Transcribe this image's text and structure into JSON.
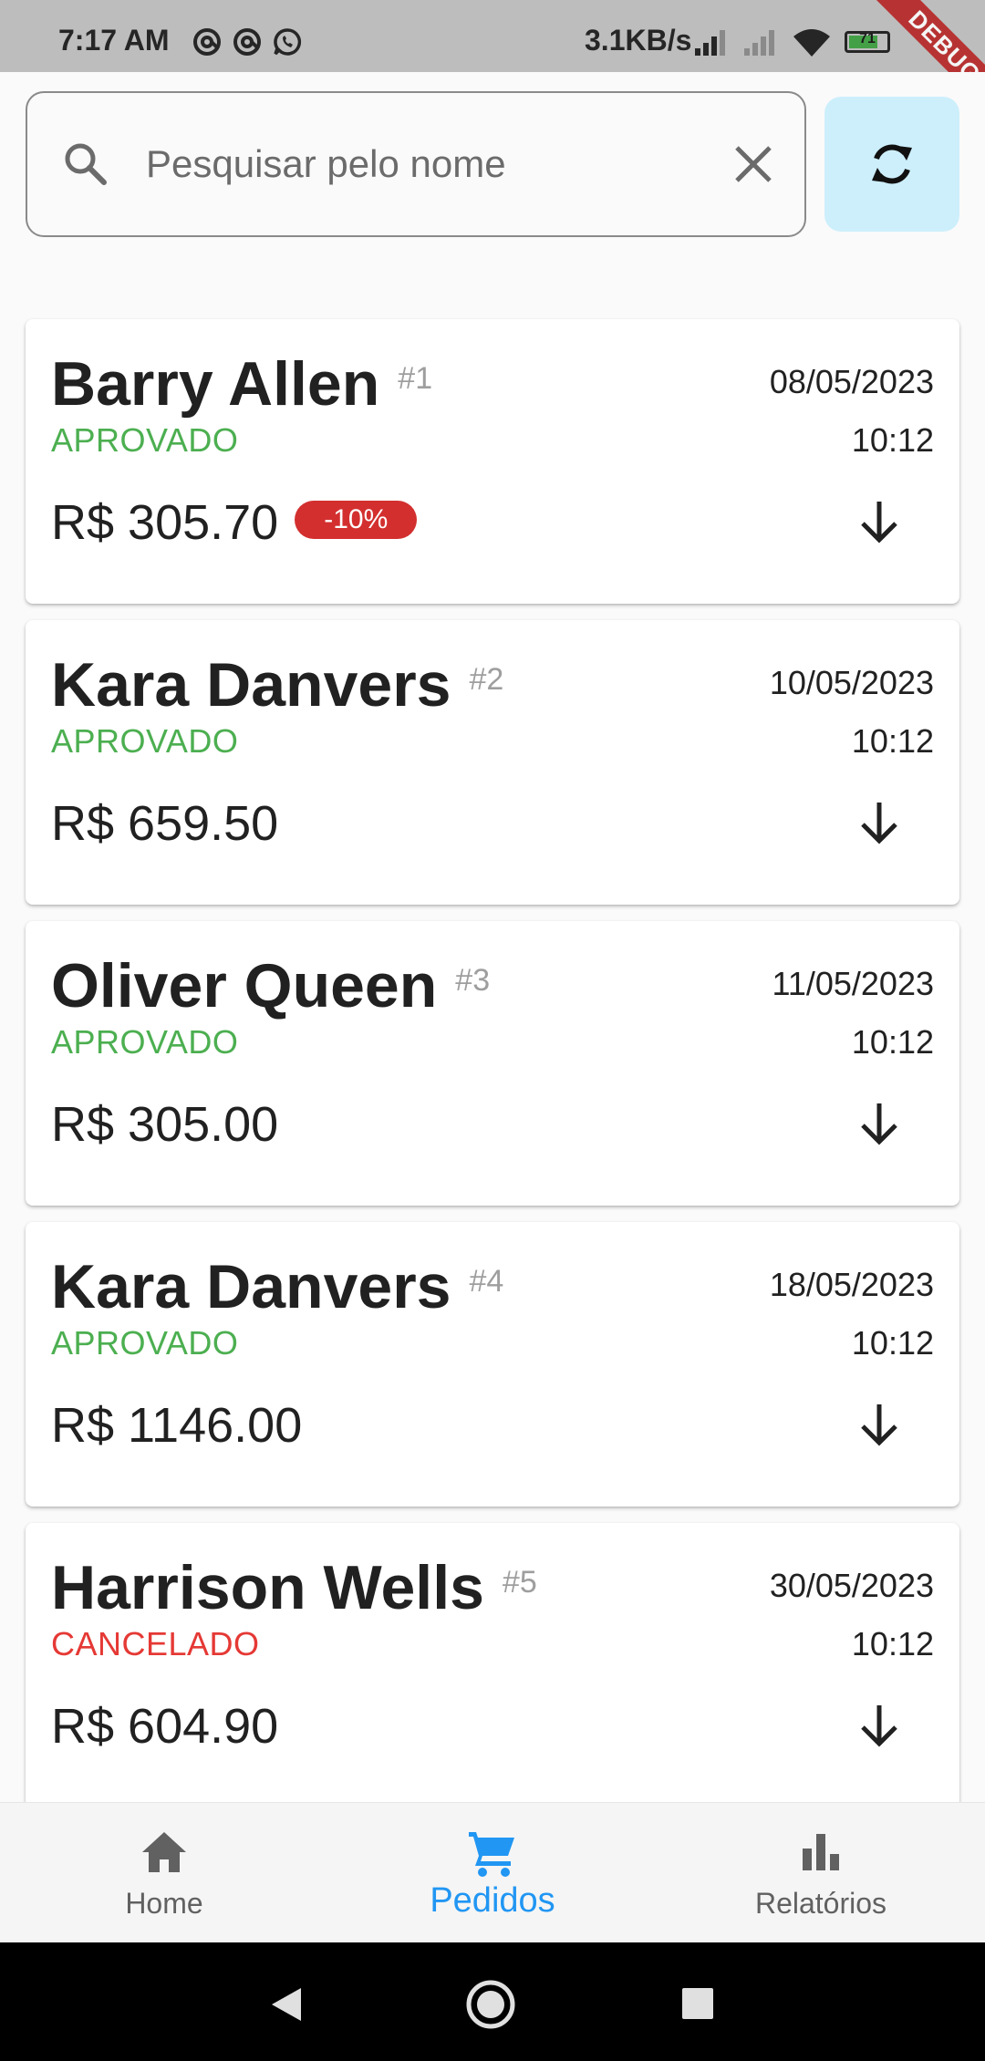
{
  "status_bar": {
    "time": "7:17 AM",
    "network_speed": "3.1KB/s",
    "battery_level": "71",
    "icons_left": [
      "at-sign-icon",
      "at-sign-icon",
      "whatsapp-icon"
    ],
    "icons_right": [
      "signal-icon",
      "signal-off-icon",
      "wifi-icon",
      "battery-icon"
    ]
  },
  "debug_banner": "DEBUG",
  "search": {
    "placeholder": "Pesquisar pelo nome",
    "value": "",
    "search_icon": "search-icon",
    "clear_icon": "close-icon"
  },
  "refresh_button": {
    "icon": "refresh-icon",
    "color": "#cdeffc"
  },
  "colors": {
    "approved": "#4caf50",
    "cancelled": "#e53935",
    "discount_badge": "#d32f2f",
    "nav_active": "#2196f3",
    "nav_inactive": "#616161"
  },
  "orders": [
    {
      "name": "Barry Allen",
      "id": "#1",
      "status": "APROVADO",
      "status_color": "#4caf50",
      "date": "08/05/2023",
      "time": "10:12",
      "total": "R$ 305.70",
      "discount": "-10%"
    },
    {
      "name": "Kara Danvers",
      "id": "#2",
      "status": "APROVADO",
      "status_color": "#4caf50",
      "date": "10/05/2023",
      "time": "10:12",
      "total": "R$ 659.50",
      "discount": ""
    },
    {
      "name": "Oliver Queen",
      "id": "#3",
      "status": "APROVADO",
      "status_color": "#4caf50",
      "date": "11/05/2023",
      "time": "10:12",
      "total": "R$ 305.00",
      "discount": ""
    },
    {
      "name": "Kara Danvers",
      "id": "#4",
      "status": "APROVADO",
      "status_color": "#4caf50",
      "date": "18/05/2023",
      "time": "10:12",
      "total": "R$ 1146.00",
      "discount": ""
    },
    {
      "name": "Harrison Wells",
      "id": "#5",
      "status": "CANCELADO",
      "status_color": "#e53935",
      "date": "30/05/2023",
      "time": "10:12",
      "total": "R$ 604.90",
      "discount": ""
    }
  ],
  "bottom_nav": {
    "items": [
      {
        "label": "Home",
        "icon": "home-icon",
        "active": false
      },
      {
        "label": "Pedidos",
        "icon": "cart-icon",
        "active": true
      },
      {
        "label": "Relatórios",
        "icon": "bar-chart-icon",
        "active": false
      }
    ]
  },
  "system_nav": {
    "buttons": [
      "back-icon",
      "home-circle-icon",
      "recents-icon"
    ]
  }
}
